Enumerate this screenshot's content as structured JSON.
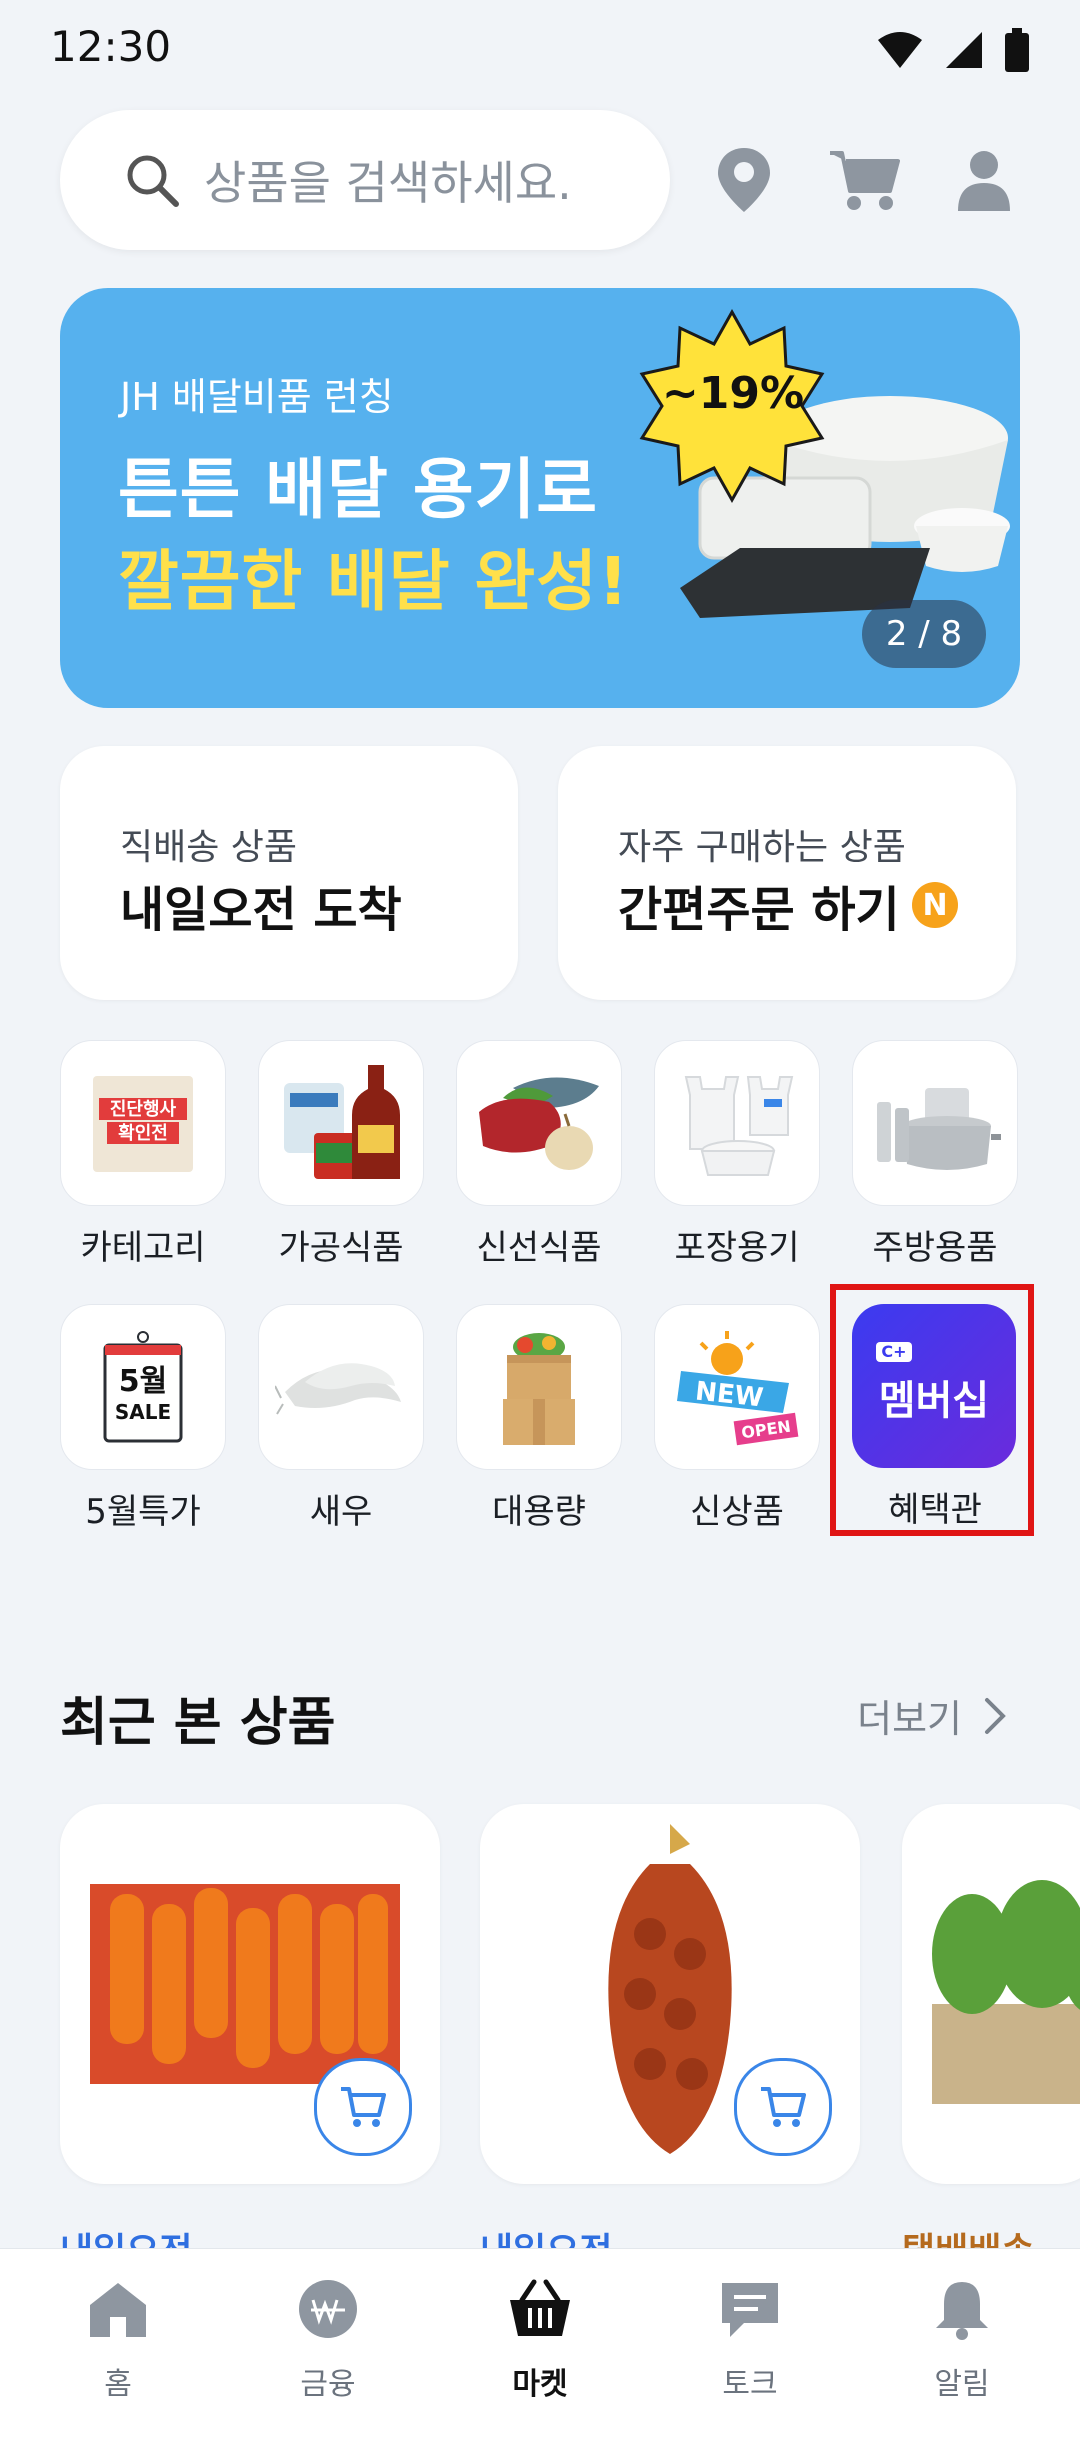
{
  "status_bar": {
    "time": "12:30"
  },
  "search": {
    "placeholder": "상품을 검색하세요."
  },
  "banner": {
    "subtitle": "JH 배달비품 런칭",
    "line1": "튼튼 배달 용기로",
    "line2": "깔끔한 배달 완성!",
    "discount": "~19%",
    "pager": "2 / 8"
  },
  "quick_cards": [
    {
      "subtitle": "직배송 상품",
      "title": "내일오전 도착"
    },
    {
      "subtitle": "자주 구매하는 상품",
      "title": "간편주문 하기",
      "badge": "N"
    }
  ],
  "categories": [
    {
      "label": "카테고리"
    },
    {
      "label": "가공식품"
    },
    {
      "label": "신선식품"
    },
    {
      "label": "포장용기"
    },
    {
      "label": "주방용품"
    },
    {
      "label": "5월특가"
    },
    {
      "label": "새우"
    },
    {
      "label": "대용량"
    },
    {
      "label": "신상품"
    },
    {
      "label": "혜택관"
    }
  ],
  "category_images": {
    "sale_sign_line1": "진단행사",
    "sale_sign_line2": "확인전",
    "may_calendar_line1": "5월",
    "may_calendar_line2": "SALE",
    "new_badge": "NEW",
    "open_badge": "OPEN",
    "membership_tile": "멤버십"
  },
  "recent": {
    "title": "최근 본 상품",
    "more": "더보기",
    "peek_labels": [
      "내일오전",
      "내일오전",
      "택배배송"
    ]
  },
  "bottom_nav": [
    {
      "label": "홈"
    },
    {
      "label": "금융"
    },
    {
      "label": "마켓"
    },
    {
      "label": "토크"
    },
    {
      "label": "알림"
    }
  ],
  "colors": {
    "background": "#f1f4f8",
    "banner": "#56b1ee",
    "banner_highlight": "#ffe04a",
    "accent_blue": "#3a86e8",
    "n_badge": "#f7a21a",
    "highlight_box": "#e01515"
  }
}
